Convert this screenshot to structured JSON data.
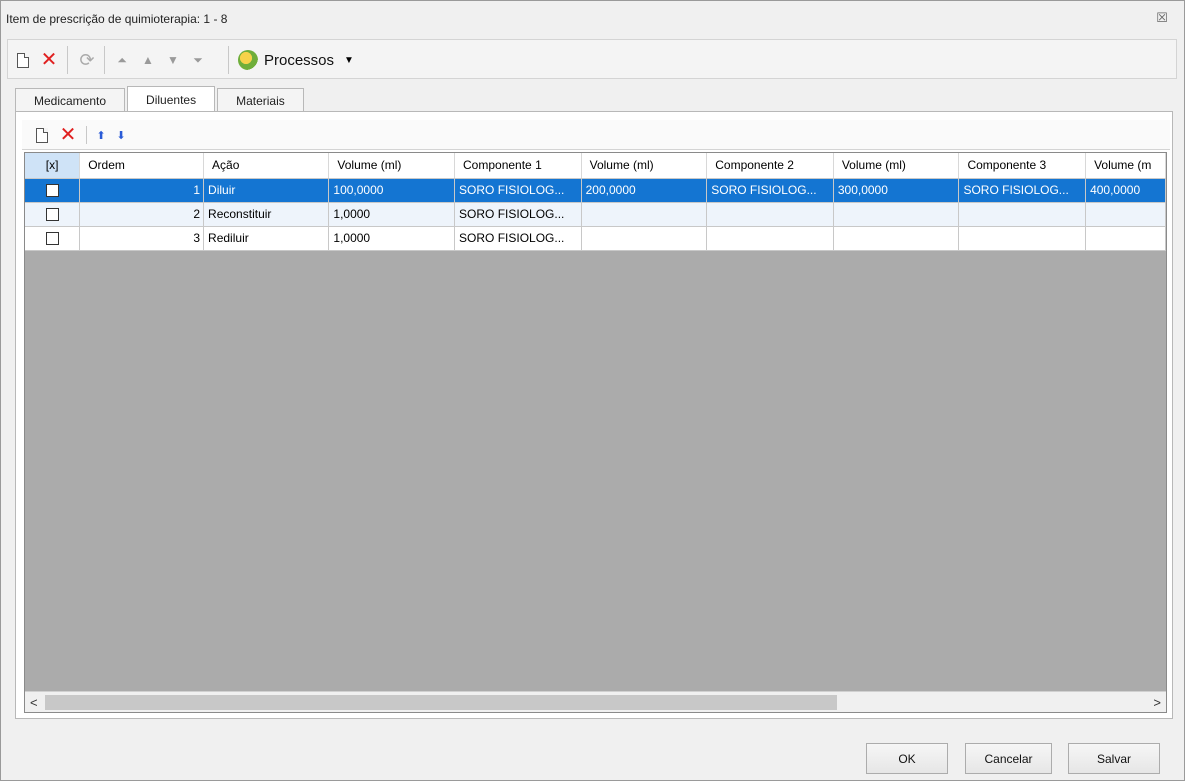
{
  "window": {
    "title": "Item de prescrição de quimioterapia: 1 - 8",
    "close_glyph": "☒"
  },
  "toolbar": {
    "processes_label": "Processos",
    "processes_caret": "▼"
  },
  "tabs": [
    {
      "label": "Medicamento",
      "active": false
    },
    {
      "label": "Diluentes",
      "active": true
    },
    {
      "label": "Materiais",
      "active": false
    }
  ],
  "grid": {
    "columns": [
      "[x]",
      "Ordem",
      "Ação",
      "Volume (ml)",
      "Componente 1",
      "Volume (ml)",
      "Componente 2",
      "Volume (ml)",
      "Componente 3",
      "Volume (m"
    ],
    "rows": [
      {
        "ordem": "1",
        "acao": "Diluir",
        "vol1": "100,0000",
        "comp1": "SORO FISIOLOG...",
        "vol2": "200,0000",
        "comp2": "SORO FISIOLOG...",
        "vol3": "300,0000",
        "comp3": "SORO FISIOLOG...",
        "vol4": "400,0000",
        "selected": true
      },
      {
        "ordem": "2",
        "acao": "Reconstituir",
        "vol1": "1,0000",
        "comp1": "SORO FISIOLOG...",
        "vol2": "",
        "comp2": "",
        "vol3": "",
        "comp3": "",
        "vol4": ""
      },
      {
        "ordem": "3",
        "acao": "Rediluir",
        "vol1": "1,0000",
        "comp1": "SORO FISIOLOG...",
        "vol2": "",
        "comp2": "",
        "vol3": "",
        "comp3": "",
        "vol4": ""
      }
    ]
  },
  "scroll": {
    "left_glyph": "<",
    "right_glyph": ">"
  },
  "footer": {
    "ok_label": "OK",
    "cancel_label": "Cancelar",
    "save_label": "Salvar"
  },
  "icons": {
    "new": "new-document-icon",
    "delete": "delete-icon",
    "refresh": "refresh-icon",
    "first": "move-first-icon",
    "up": "move-up-icon",
    "down": "move-down-icon",
    "last": "move-last-icon",
    "processes": "processes-icon"
  },
  "colors": {
    "selection": "#1475d2",
    "delete_red": "#e02020",
    "arrow_blue": "#2a5bd7"
  }
}
